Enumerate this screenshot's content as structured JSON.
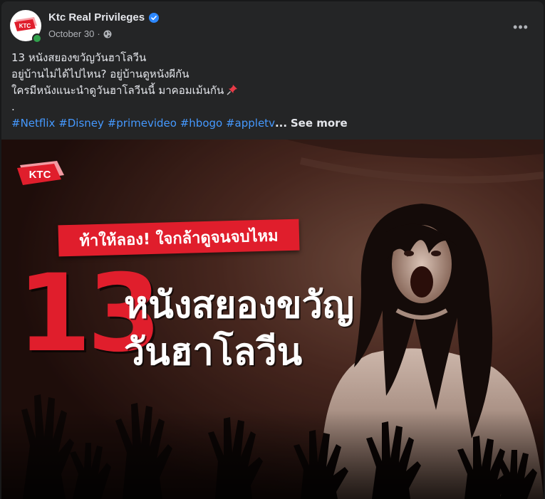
{
  "post": {
    "page_name": "Ktc Real Privileges",
    "date": "October 30",
    "separator": "·",
    "avatar_logo_text": "KTC",
    "more_label": "•••",
    "caption_lines": [
      "13 หนังสยองขวัญวันฮาโลวีน",
      "อยู่บ้านไม่ได้ไปไหน? อยู่บ้านดูหนังผีกัน",
      "ใครมีหนังแนะนำดูวันฮาโลวีนนี้ มาคอมเม้นกัน",
      "."
    ],
    "hashtags": [
      "#Netflix",
      "#Disney",
      "#primevideo",
      "#hbogo",
      "#appletv"
    ],
    "ellipsis": "...",
    "see_more": "See more",
    "icons": {
      "verified": "verified-badge-icon",
      "globe": "globe-icon",
      "pin": "pushpin-icon",
      "more": "more-options-icon"
    },
    "colors": {
      "background": "#242526",
      "text": "#e4e6eb",
      "secondary_text": "#b0b3b8",
      "hashtag": "#4599ff",
      "verified": "#2d88ff",
      "online": "#31a24c",
      "brand_red": "#e01e2c"
    }
  },
  "image": {
    "logo_text": "KTC",
    "banner": "ท้าให้ลอง! ใจกล้าดูจนจบไหม",
    "number": "13",
    "title_line1": "หนังสยองขวัญ",
    "title_line2": "วันฮาโลวีน"
  }
}
